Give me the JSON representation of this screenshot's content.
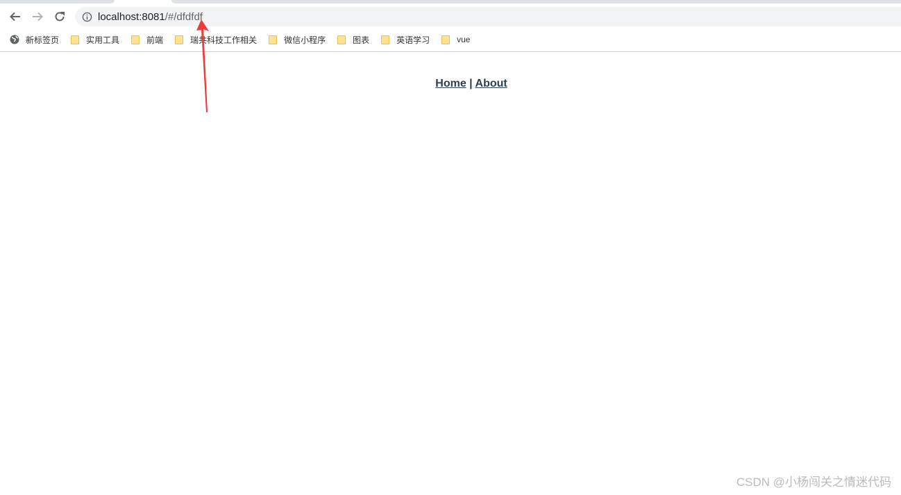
{
  "browser": {
    "url_host": "localhost:8081",
    "url_path": "/#/dfdfdf",
    "bookmarks": [
      {
        "label": "新标签页",
        "icon": "globe-icon"
      },
      {
        "label": "实用工具",
        "icon": "folder-icon"
      },
      {
        "label": "前端",
        "icon": "folder-icon"
      },
      {
        "label": "瑞共科技工作相关",
        "icon": "folder-icon"
      },
      {
        "label": "微信小程序",
        "icon": "folder-icon"
      },
      {
        "label": "图表",
        "icon": "folder-icon"
      },
      {
        "label": "英语学习",
        "icon": "folder-icon"
      },
      {
        "label": "vue",
        "icon": "folder-icon"
      }
    ]
  },
  "app": {
    "nav_home": "Home",
    "separator": "|",
    "nav_about": "About"
  },
  "annotation": {
    "arrow_color": "#f03a3a"
  },
  "watermark": "CSDN @小杨闯关之情迷代码"
}
